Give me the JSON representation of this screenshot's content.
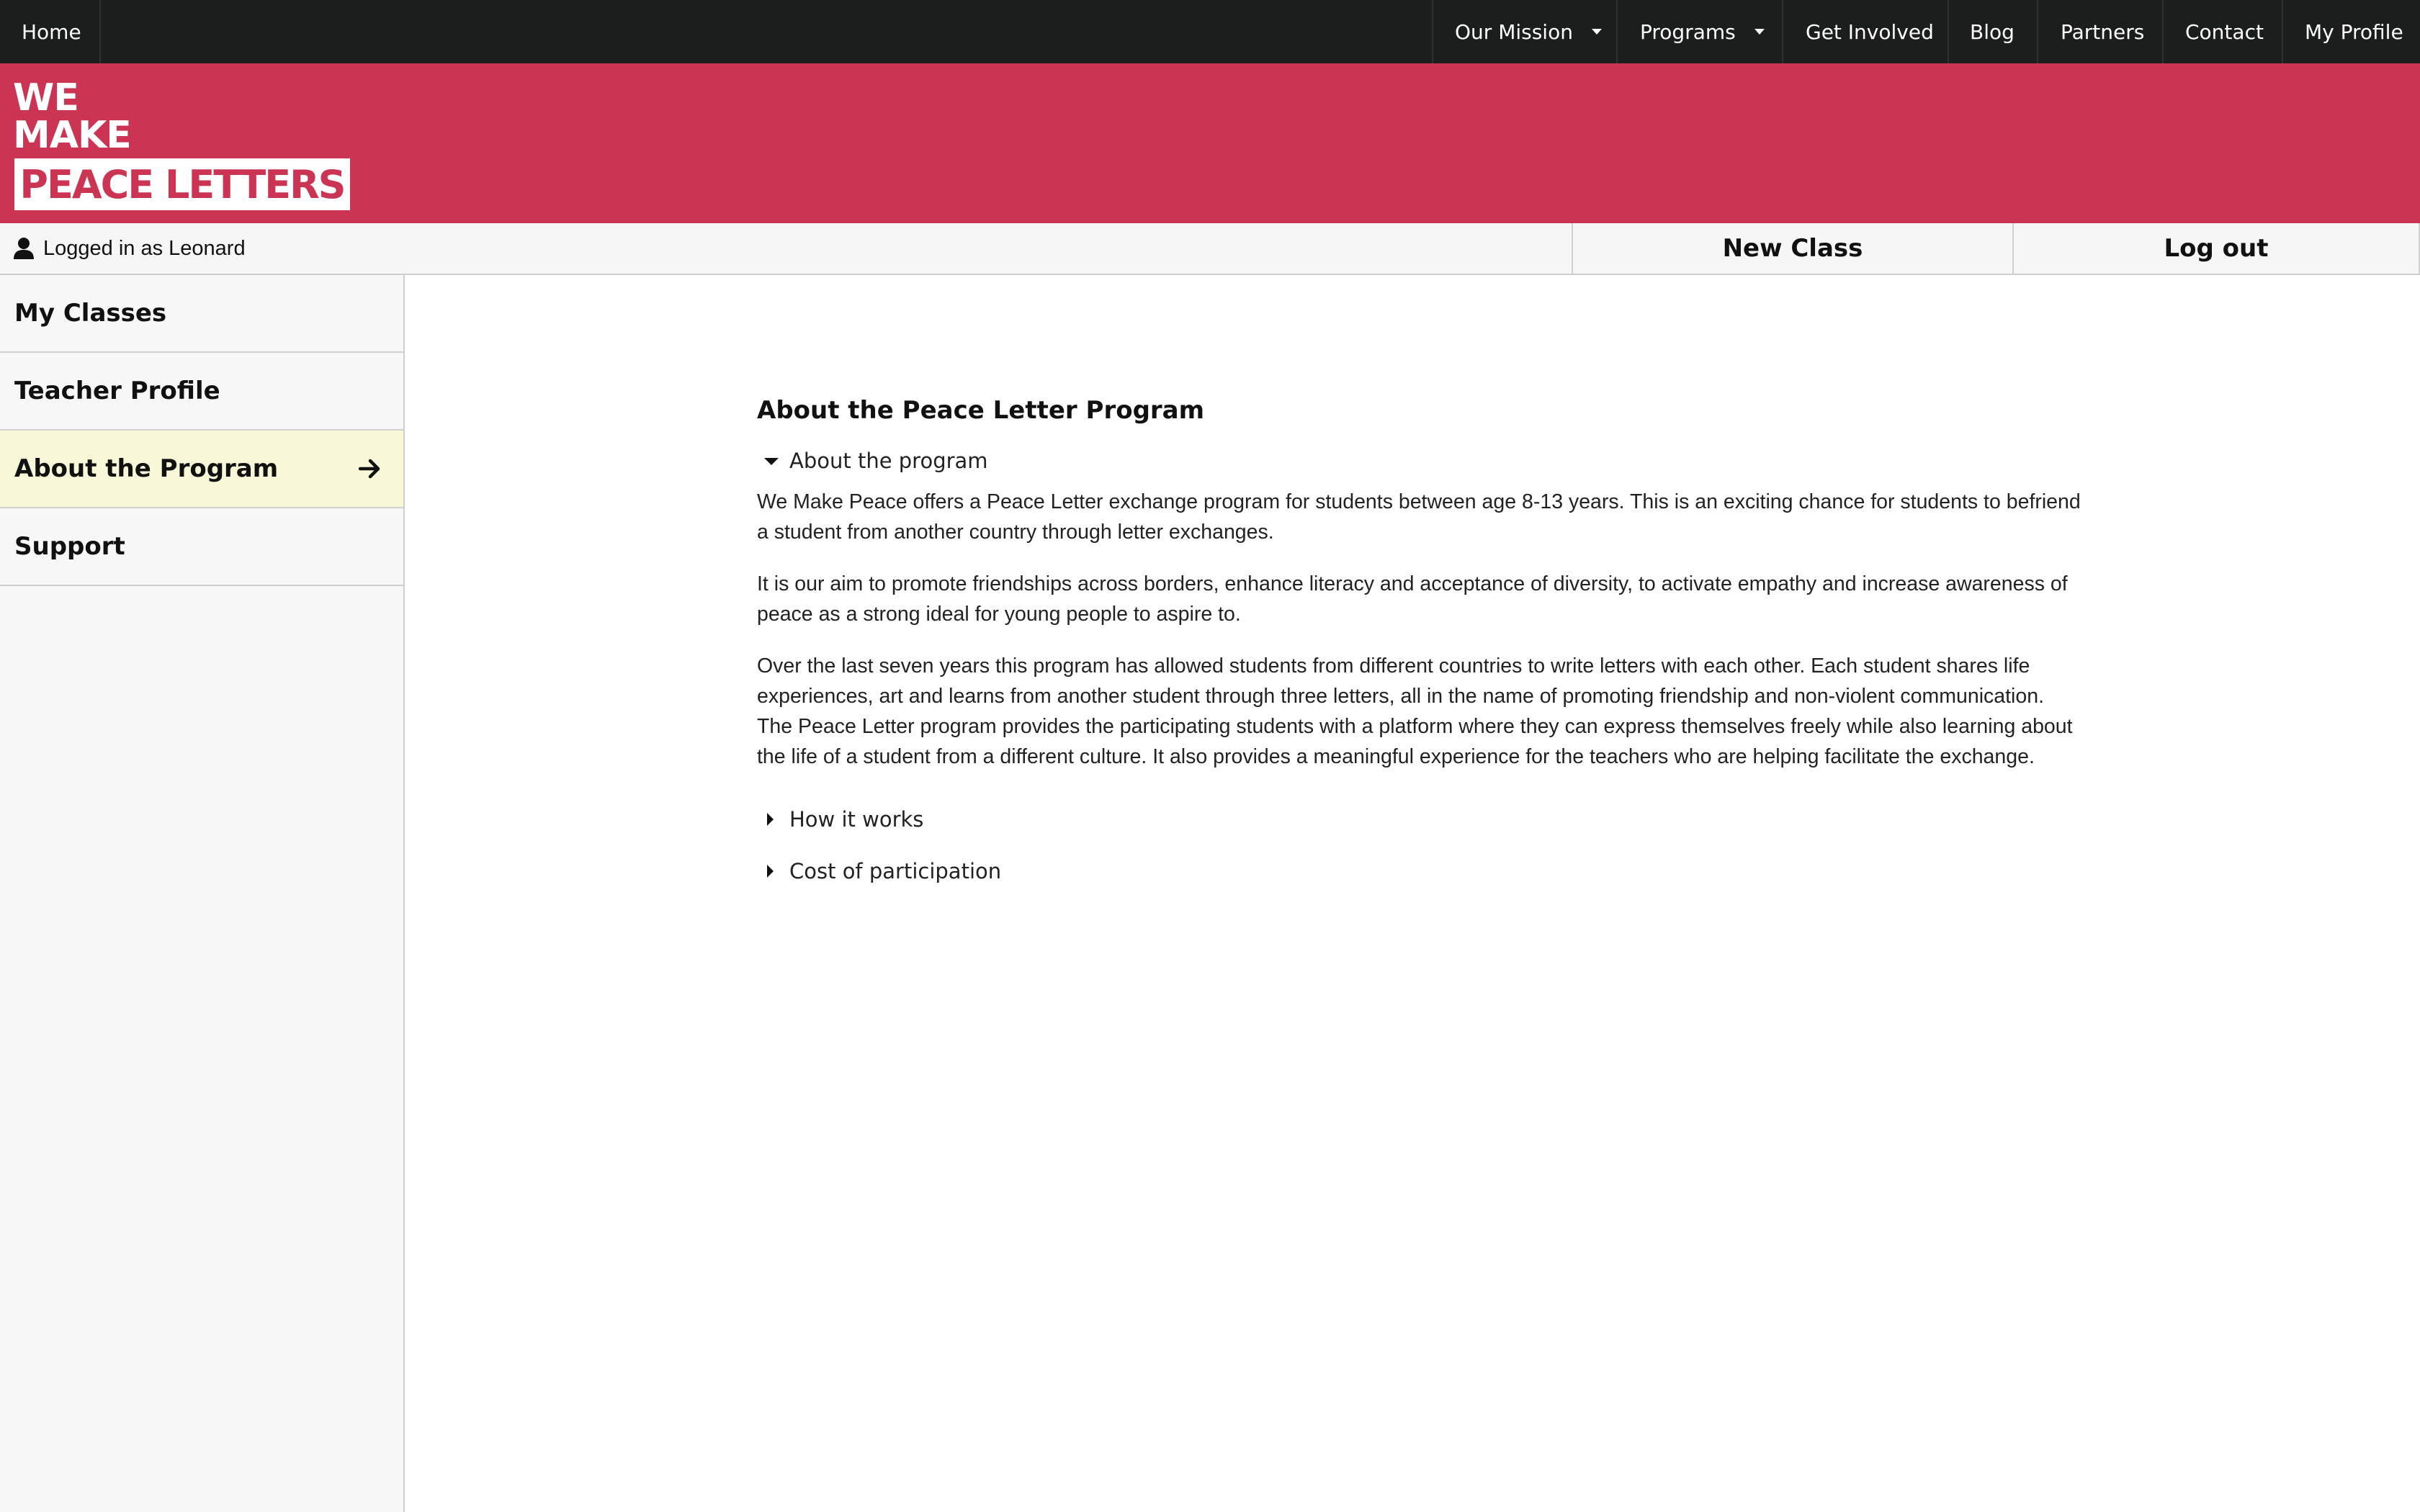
{
  "topnav": {
    "home": "Home",
    "items": [
      {
        "label": "Our Mission",
        "dropdown": true
      },
      {
        "label": "Programs",
        "dropdown": true
      },
      {
        "label": "Get Involved",
        "dropdown": false
      },
      {
        "label": "Blog",
        "dropdown": false
      },
      {
        "label": "Partners",
        "dropdown": false
      },
      {
        "label": "Contact",
        "dropdown": false
      },
      {
        "label": "My Profile",
        "dropdown": false
      }
    ]
  },
  "logo": {
    "line1": "WE",
    "line2": "MAKE",
    "line3": "PEACE LETTERS"
  },
  "status": {
    "logged_in": "Logged in as Leonard",
    "new_class": "New Class",
    "logout": "Log out"
  },
  "sidebar": {
    "items": [
      {
        "label": "My Classes",
        "active": false
      },
      {
        "label": "Teacher Profile",
        "active": false
      },
      {
        "label": "About the Program",
        "active": true
      },
      {
        "label": "Support",
        "active": false
      }
    ]
  },
  "main": {
    "title": "About the Peace Letter Program",
    "sections": [
      {
        "summary": "About the program",
        "open": true,
        "paragraphs": [
          "We Make Peace offers a Peace Letter exchange program for students between age 8-13 years. This is an exciting chance for students to befriend a student from another country through letter exchanges.",
          "It is our aim to promote friendships across borders, enhance literacy and acceptance of diversity, to activate empathy and increase awareness of peace as a strong ideal for young people to aspire to.",
          "Over the last seven years this program has allowed students from different countries to write letters with each other. Each student shares life experiences, art and learns from another student through three letters, all in the name of promoting friendship and non-violent communication. The Peace Letter program provides the participating students with a platform where they can express themselves freely while also learning about the life of a student from a different culture. It also provides a meaningful experience for the teachers who are helping facilitate the exchange."
        ]
      },
      {
        "summary": "How it works",
        "open": false
      },
      {
        "summary": "Cost of participation",
        "open": false
      }
    ]
  },
  "colors": {
    "brand": "#cb3452",
    "nav_bg": "#1c1d1d",
    "active_item_bg": "#f8f8d8"
  }
}
